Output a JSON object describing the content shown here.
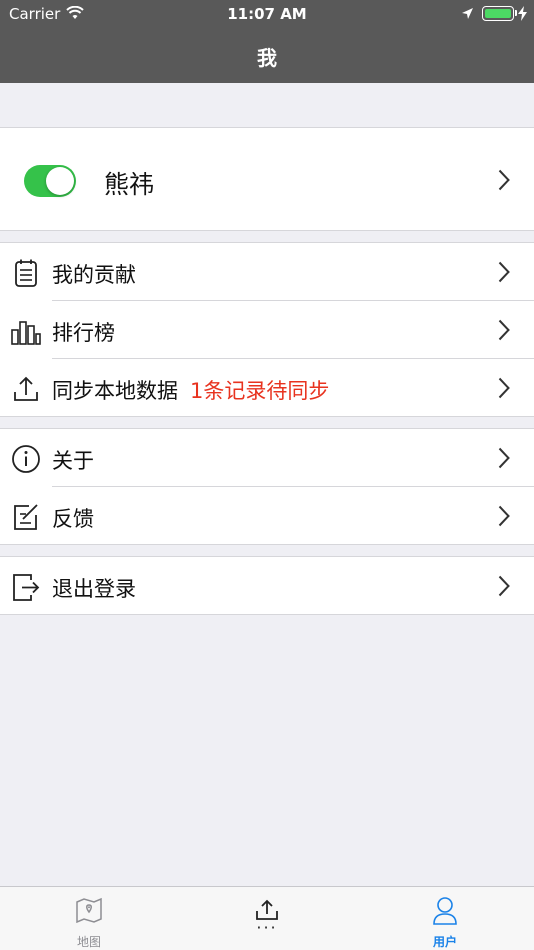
{
  "status_bar": {
    "carrier": "Carrier",
    "time": "11:07 AM"
  },
  "nav": {
    "title": "我"
  },
  "profile": {
    "name": "熊祎",
    "toggle_on": true
  },
  "menu_group_1": [
    {
      "label": "我的贡献",
      "icon": "clipboard-icon"
    },
    {
      "label": "排行榜",
      "icon": "bar-chart-icon"
    },
    {
      "label": "同步本地数据",
      "extra": "1条记录待同步",
      "icon": "upload-icon"
    }
  ],
  "menu_group_2": [
    {
      "label": "关于",
      "icon": "info-icon"
    },
    {
      "label": "反馈",
      "icon": "edit-icon"
    }
  ],
  "menu_group_3": [
    {
      "label": "退出登录",
      "icon": "logout-icon"
    }
  ],
  "tabbar": {
    "items": [
      {
        "label": "地图",
        "icon": "map-icon",
        "active": false
      },
      {
        "label": "",
        "dots": "···",
        "icon": "upload-icon",
        "active": false
      },
      {
        "label": "用户",
        "icon": "user-icon",
        "active": true
      }
    ]
  },
  "colors": {
    "header_bg": "#595959",
    "toggle": "#35c24a",
    "accent": "#1a82e8",
    "warning": "#e8331f"
  }
}
